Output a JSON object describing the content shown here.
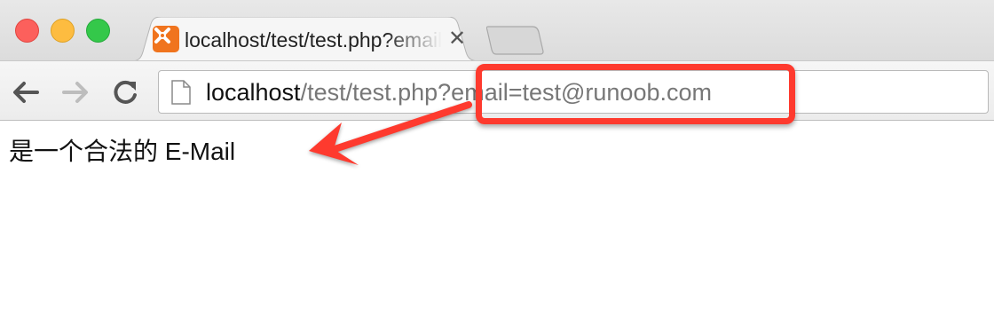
{
  "window": {
    "controls": [
      "close",
      "minimize",
      "maximize"
    ]
  },
  "tab": {
    "title": "localhost/test/test.php?email=test@runoob.com",
    "favicon": "xampp-icon",
    "close_label": "✕"
  },
  "toolbar": {
    "back_icon": "arrow-left-icon",
    "forward_icon": "arrow-right-icon",
    "reload_icon": "reload-icon"
  },
  "address_bar": {
    "host": "localhost",
    "path": "/test/test.php?email=test@runoob.com"
  },
  "page": {
    "message": "是一个合法的 E-Mail"
  },
  "annotation": {
    "color": "#fe3a2e"
  }
}
